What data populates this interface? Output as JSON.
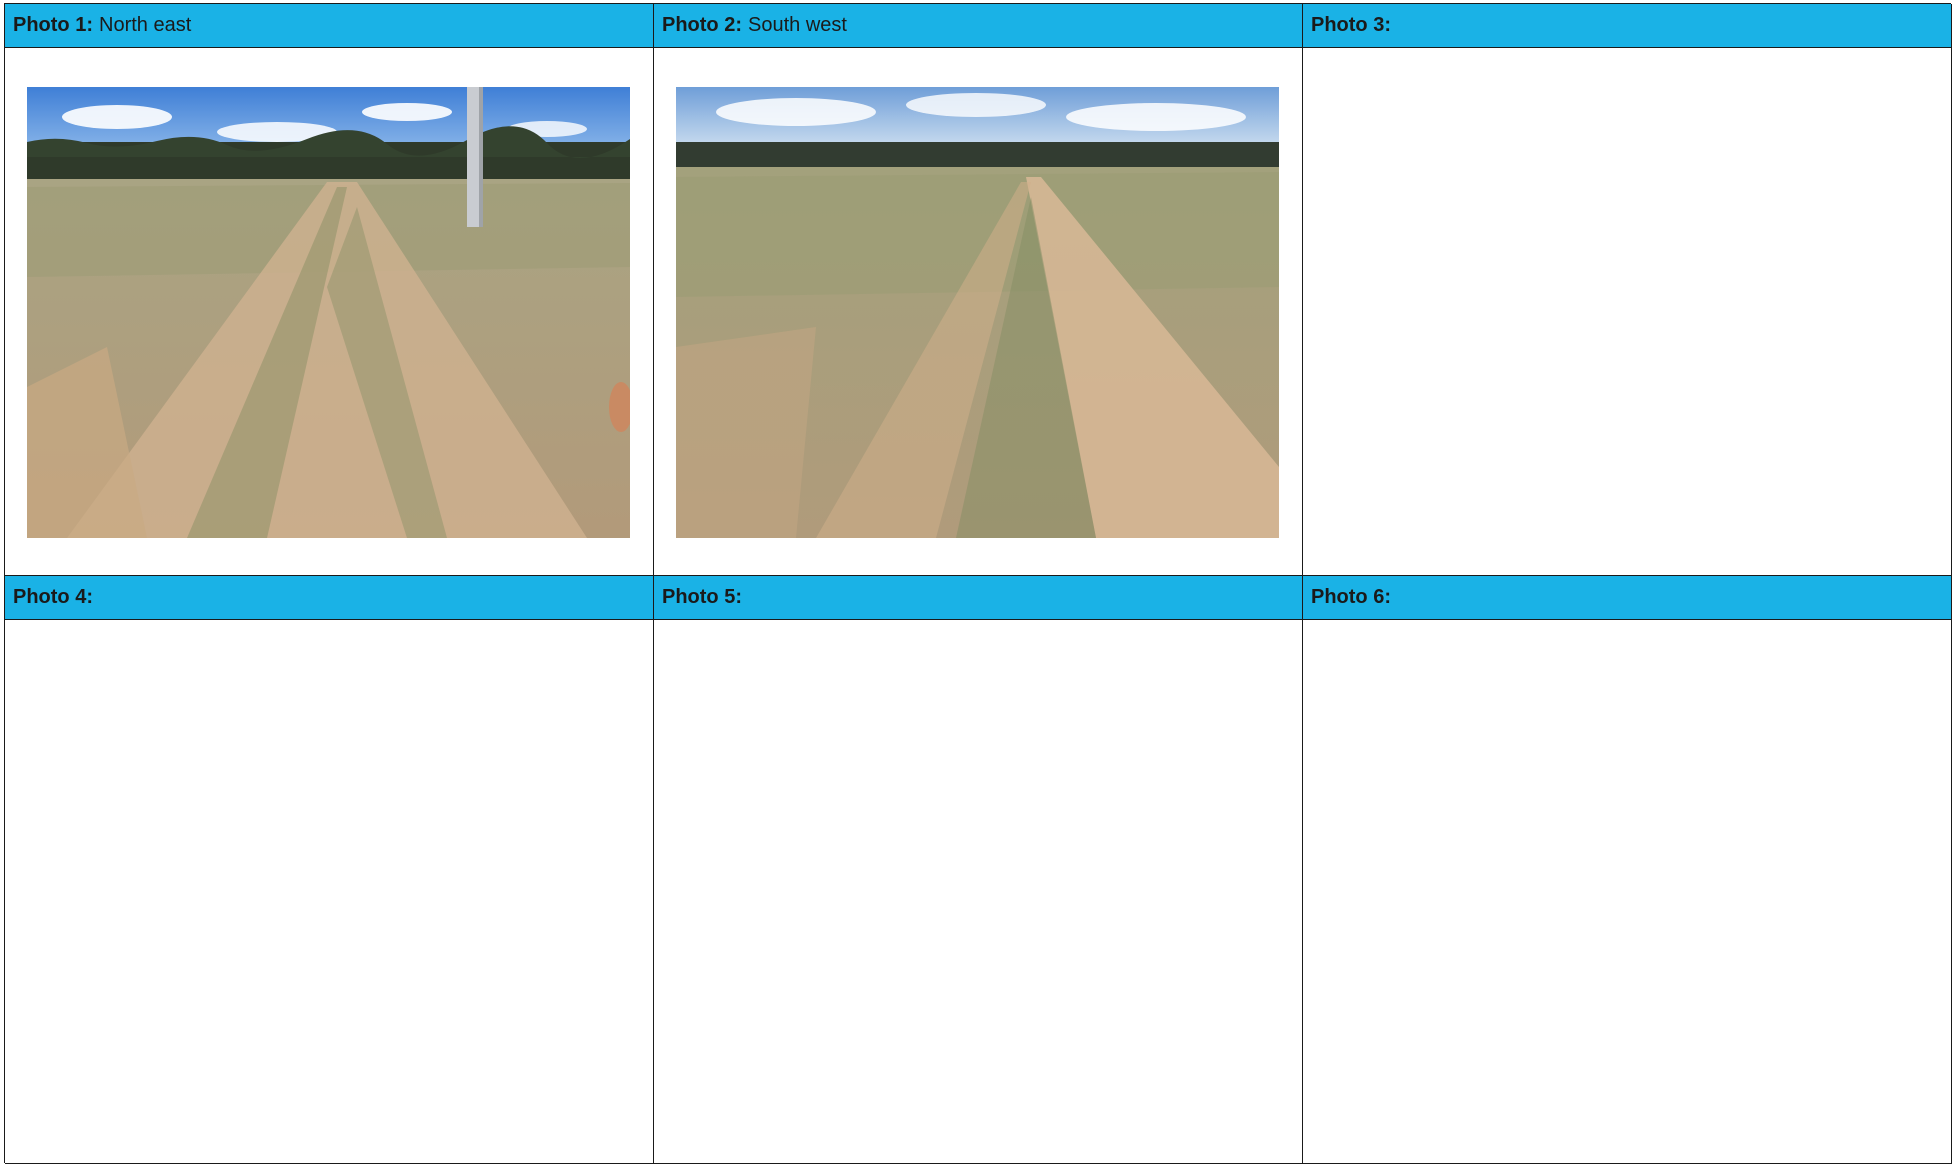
{
  "cells": [
    {
      "number": "Photo 1:",
      "description": "North east",
      "has_photo": true,
      "photo_subject": "grassy-field-dirt-track-with-pole"
    },
    {
      "number": "Photo 2:",
      "description": "South west",
      "has_photo": true,
      "photo_subject": "grassy-field-dirt-track"
    },
    {
      "number": "Photo 3:",
      "description": "",
      "has_photo": false
    },
    {
      "number": "Photo 4:",
      "description": "",
      "has_photo": false
    },
    {
      "number": "Photo 5:",
      "description": "",
      "has_photo": false
    },
    {
      "number": "Photo 6:",
      "description": "",
      "has_photo": false
    }
  ],
  "colors": {
    "header": "#1ab2e6",
    "border": "#1a1a1a",
    "text": "#1a1a1a",
    "background": "#ffffff"
  }
}
